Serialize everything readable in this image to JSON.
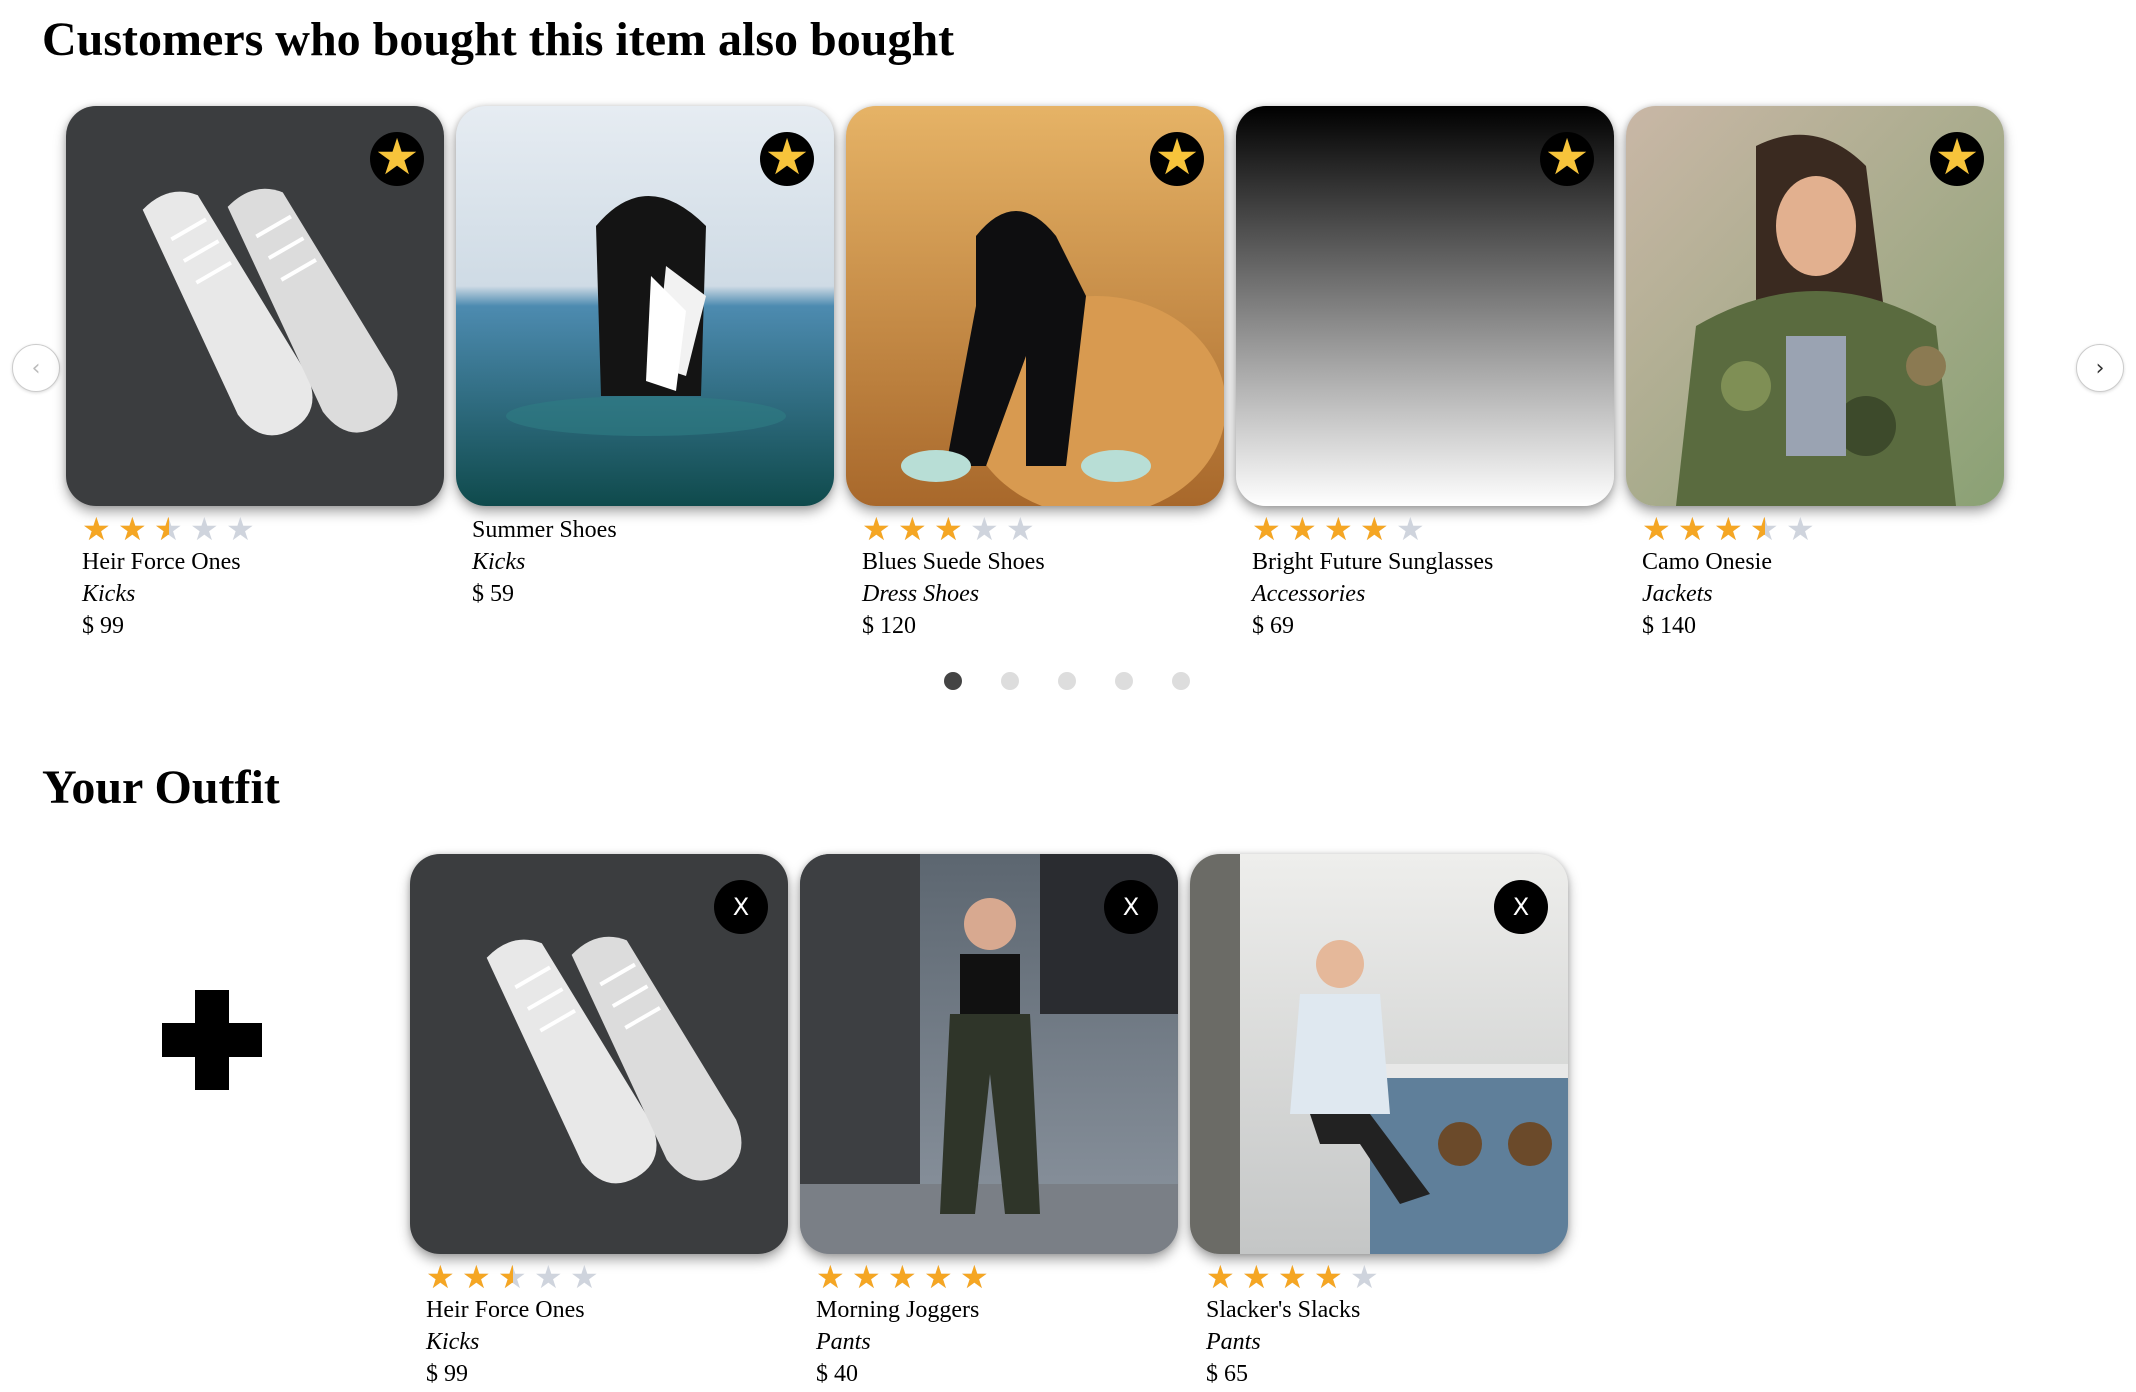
{
  "related": {
    "title": "Customers who bought this item also bought",
    "action_icon": "star-icon",
    "action_glyph": "★",
    "accent_color": "#f7c43b",
    "star_color": "#f5a623",
    "items": [
      {
        "name": "Heir Force Ones",
        "category": "Kicks",
        "price": "$ 99",
        "rating": 2.5,
        "image": "white-sneakers-photo"
      },
      {
        "name": "Summer Shoes",
        "category": "Kicks",
        "price": "$ 59",
        "rating": null,
        "image": "man-in-ocean-holding-shoes-photo"
      },
      {
        "name": "Blues Suede Shoes",
        "category": "Dress Shoes",
        "price": "$ 120",
        "rating": 3,
        "image": "man-on-fur-beanbag-photo"
      },
      {
        "name": "Bright Future Sunglasses",
        "category": "Accessories",
        "price": "$ 69",
        "rating": 4,
        "image": "black-gradient-placeholder"
      },
      {
        "name": "Camo Onesie",
        "category": "Jackets",
        "price": "$ 140",
        "rating": 3.5,
        "image": "woman-in-camo-jacket-photo"
      }
    ],
    "prev_glyph": "‹",
    "next_glyph": "›",
    "pagination": {
      "count": 5,
      "active": 0
    }
  },
  "outfit": {
    "title": "Your Outfit",
    "add_icon": "plus-icon",
    "remove_label": "X",
    "items": [
      {
        "name": "Heir Force Ones",
        "category": "Kicks",
        "price": "$ 99",
        "rating": 2.5,
        "image": "white-sneakers-photo"
      },
      {
        "name": "Morning Joggers",
        "category": "Pants",
        "price": "$ 40",
        "rating": 5,
        "image": "woman-in-joggers-photo"
      },
      {
        "name": "Slacker's Slacks",
        "category": "Pants",
        "price": "$ 65",
        "rating": 4,
        "image": "man-at-cafe-bar-photo"
      }
    ]
  }
}
